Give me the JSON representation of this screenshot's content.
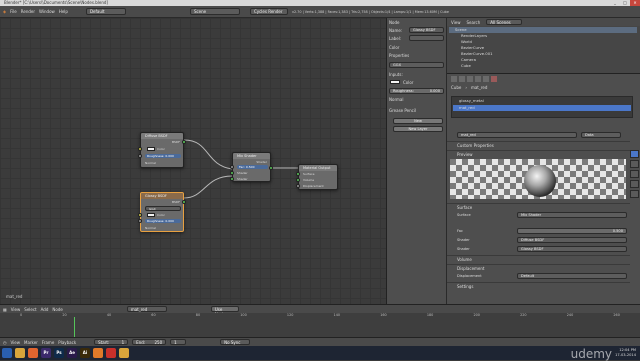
{
  "window": {
    "title": "Blender* [C:\\Users\\\\Documents\\Scene\\Nodes.blend]",
    "min": "_",
    "max": "□",
    "close": "✕"
  },
  "infobar": {
    "menus": [
      "File",
      "Render",
      "Window",
      "Help"
    ],
    "layout": "Default",
    "scene": "Scene",
    "engine": "Cycles Render",
    "stats": "v2.70 | Verts:1,388 | Faces:1,383 | Tris:2,758 | Objects:1/4 | Lamps:1/1 | Mem:13.60M | Cube"
  },
  "nodes": {
    "diffuse": {
      "title": "Diffuse BSDF",
      "out": "BSDF",
      "color": "Color",
      "rough_label": "Roughness: 0.000",
      "normal": "Normal"
    },
    "glossy": {
      "title": "Glossy BSDF",
      "out": "BSDF",
      "dist": "GGX",
      "color": "Color",
      "rough_label": "Roughness: 0.000",
      "normal": "Normal"
    },
    "mix": {
      "title": "Mix Shader",
      "out": "Shader",
      "fac": "Fac: 0.500",
      "s1": "Shader",
      "s2": "Shader"
    },
    "output": {
      "title": "Material Output",
      "surface": "Surface",
      "volume": "Volume",
      "disp": "Displacement"
    }
  },
  "node_editor": {
    "material_name": "mat_red",
    "header_menus": [
      "View",
      "Select",
      "Add",
      "Node"
    ],
    "mat_field": "mat_red",
    "use_nodes": "Use Nodes"
  },
  "tool_panel": {
    "node_header": "Node",
    "name_label": "Name:",
    "name_value": "Glossy BSDF",
    "label_label": "Label:",
    "color_label": "Color",
    "properties_header": "Properties",
    "dist": "GGX",
    "inputs_label": "Inputs:",
    "color_in": "Color",
    "roughness": "Roughness:",
    "roughness_val": "0.000",
    "normal": "Normal",
    "grease_header": "Grease Pencil",
    "new_btn": "New",
    "new_layer_btn": "New Layer"
  },
  "outliner": {
    "header_menus": [
      "View",
      "Search"
    ],
    "filter": "All Scenes",
    "rows": [
      "Scene",
      "RenderLayers",
      "World",
      "BezierCurve",
      "BezierCurve.001",
      "Camera",
      "Cube"
    ]
  },
  "properties": {
    "breadcrumb": [
      "Cube",
      "mat_red"
    ],
    "materials": [
      "glossy_metal",
      "mat_red"
    ],
    "mat_name": "mat_red",
    "data_label": "Data",
    "sections": {
      "custom": "Custom Properties",
      "preview": "Preview",
      "surface": "Surface",
      "volume": "Volume",
      "displacement": "Displacement",
      "settings": "Settings"
    },
    "surface_label": "Surface",
    "surface_value": "Mix Shader",
    "fac_label": "Fac",
    "fac_value": "0.500",
    "shader1_label": "Shader",
    "shader1_value": "Diffuse BSDF",
    "shader2_label": "Shader",
    "shader2_value": "Glossy BSDF",
    "disp_label": "Displacement",
    "disp_value": "Default"
  },
  "timeline": {
    "menus": [
      "View",
      "Marker",
      "Frame",
      "Playback"
    ],
    "start": "Start:",
    "start_v": "1",
    "end": "End:",
    "end_v": "250",
    "current": "1",
    "sync": "No Sync",
    "ticks": [
      "0",
      "20",
      "40",
      "60",
      "80",
      "100",
      "120",
      "140",
      "160",
      "180",
      "200",
      "220",
      "240",
      "260"
    ]
  },
  "taskbar": {
    "icons": [
      {
        "name": "windows-icon",
        "label": "",
        "color": "#2a5fb0"
      },
      {
        "name": "explorer-icon",
        "label": "",
        "color": "#d9a53b"
      },
      {
        "name": "firefox-icon",
        "label": "",
        "color": "#e0652f"
      },
      {
        "name": "premiere-icon",
        "label": "Pr",
        "color": "#3b2a6b"
      },
      {
        "name": "photoshop-icon",
        "label": "Ps",
        "color": "#0e2a4a"
      },
      {
        "name": "aftereffects-icon",
        "label": "Ae",
        "color": "#2a1a4a"
      },
      {
        "name": "illustrator-icon",
        "label": "Ai",
        "color": "#3a2a0a"
      },
      {
        "name": "blender-icon",
        "label": "",
        "color": "#e07a2a"
      },
      {
        "name": "media-icon",
        "label": "",
        "color": "#c8302a"
      },
      {
        "name": "folder-icon",
        "label": "",
        "color": "#d9a53b"
      }
    ],
    "clock": "12:04 PM",
    "date": "17-03-2014",
    "watermark": "udemy"
  }
}
